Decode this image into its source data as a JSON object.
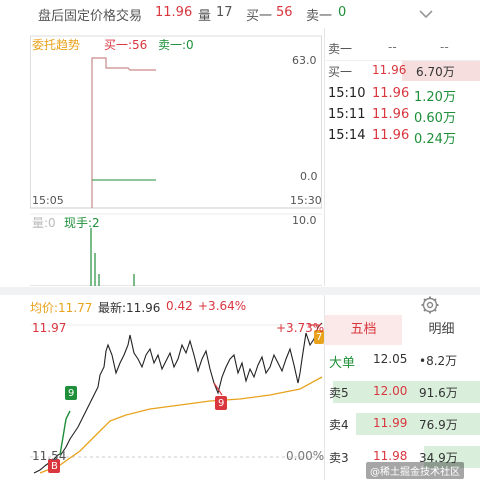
{
  "header": {
    "title": "盘后固定价格交易",
    "price": "11.96",
    "vol_label": "量",
    "vol_value": "17",
    "buy1_label": "买一",
    "buy1_value": "56",
    "sell1_label": "卖一",
    "sell1_value": "0"
  },
  "entrust": {
    "title": "委托趋势",
    "buy1": "买一:56",
    "sell1": "卖一:0",
    "y_top": "63.0",
    "y_bottom": "0.0",
    "time_start": "15:05",
    "time_end": "15:30",
    "vol_left": "量:0",
    "current": "现手:2",
    "vol_top": "10.0"
  },
  "orderbook": {
    "sell_label": "卖一",
    "sell_price": "--",
    "sell_vol": "--",
    "buy_label": "买一",
    "buy_price": "11.96",
    "buy_vol": "6.70万",
    "trades": [
      {
        "time": "15:10",
        "price": "11.96",
        "vol": "1.20万"
      },
      {
        "time": "15:11",
        "price": "11.96",
        "vol": "0.60万"
      },
      {
        "time": "15:14",
        "price": "11.96",
        "vol": "0.24万"
      }
    ]
  },
  "intraday": {
    "avg": "均价:11.77",
    "latest": "最新:11.96",
    "change": "0.42",
    "pct": "+3.64%",
    "high_price": "11.97",
    "high_pct": "+3.73%",
    "low_price": "11.54",
    "low_pct": "0.00%",
    "marker_9_a": "9",
    "marker_9_b": "9",
    "marker_7": "7",
    "marker_b": "B"
  },
  "side": {
    "tab_active": "五档",
    "tab_inactive": "明细",
    "big_label": "大单",
    "big_price": "12.05",
    "big_vol": "•8.2万",
    "rows": [
      {
        "label": "卖5",
        "price": "12.00",
        "vol": "91.6万",
        "fill": 0.95
      },
      {
        "label": "卖4",
        "price": "11.99",
        "vol": "76.9万",
        "fill": 0.8
      },
      {
        "label": "卖3",
        "price": "11.98",
        "vol": "34.9万",
        "fill": 0.36
      }
    ]
  },
  "watermark": "@稀土掘金技术社区",
  "colors": {
    "up": "#d9363e",
    "down": "#1f8f3a",
    "avg": "#e8a21c",
    "entrust_line": "#c98a8a"
  },
  "icons": [
    "chevron-down-icon",
    "gear-icon"
  ]
}
